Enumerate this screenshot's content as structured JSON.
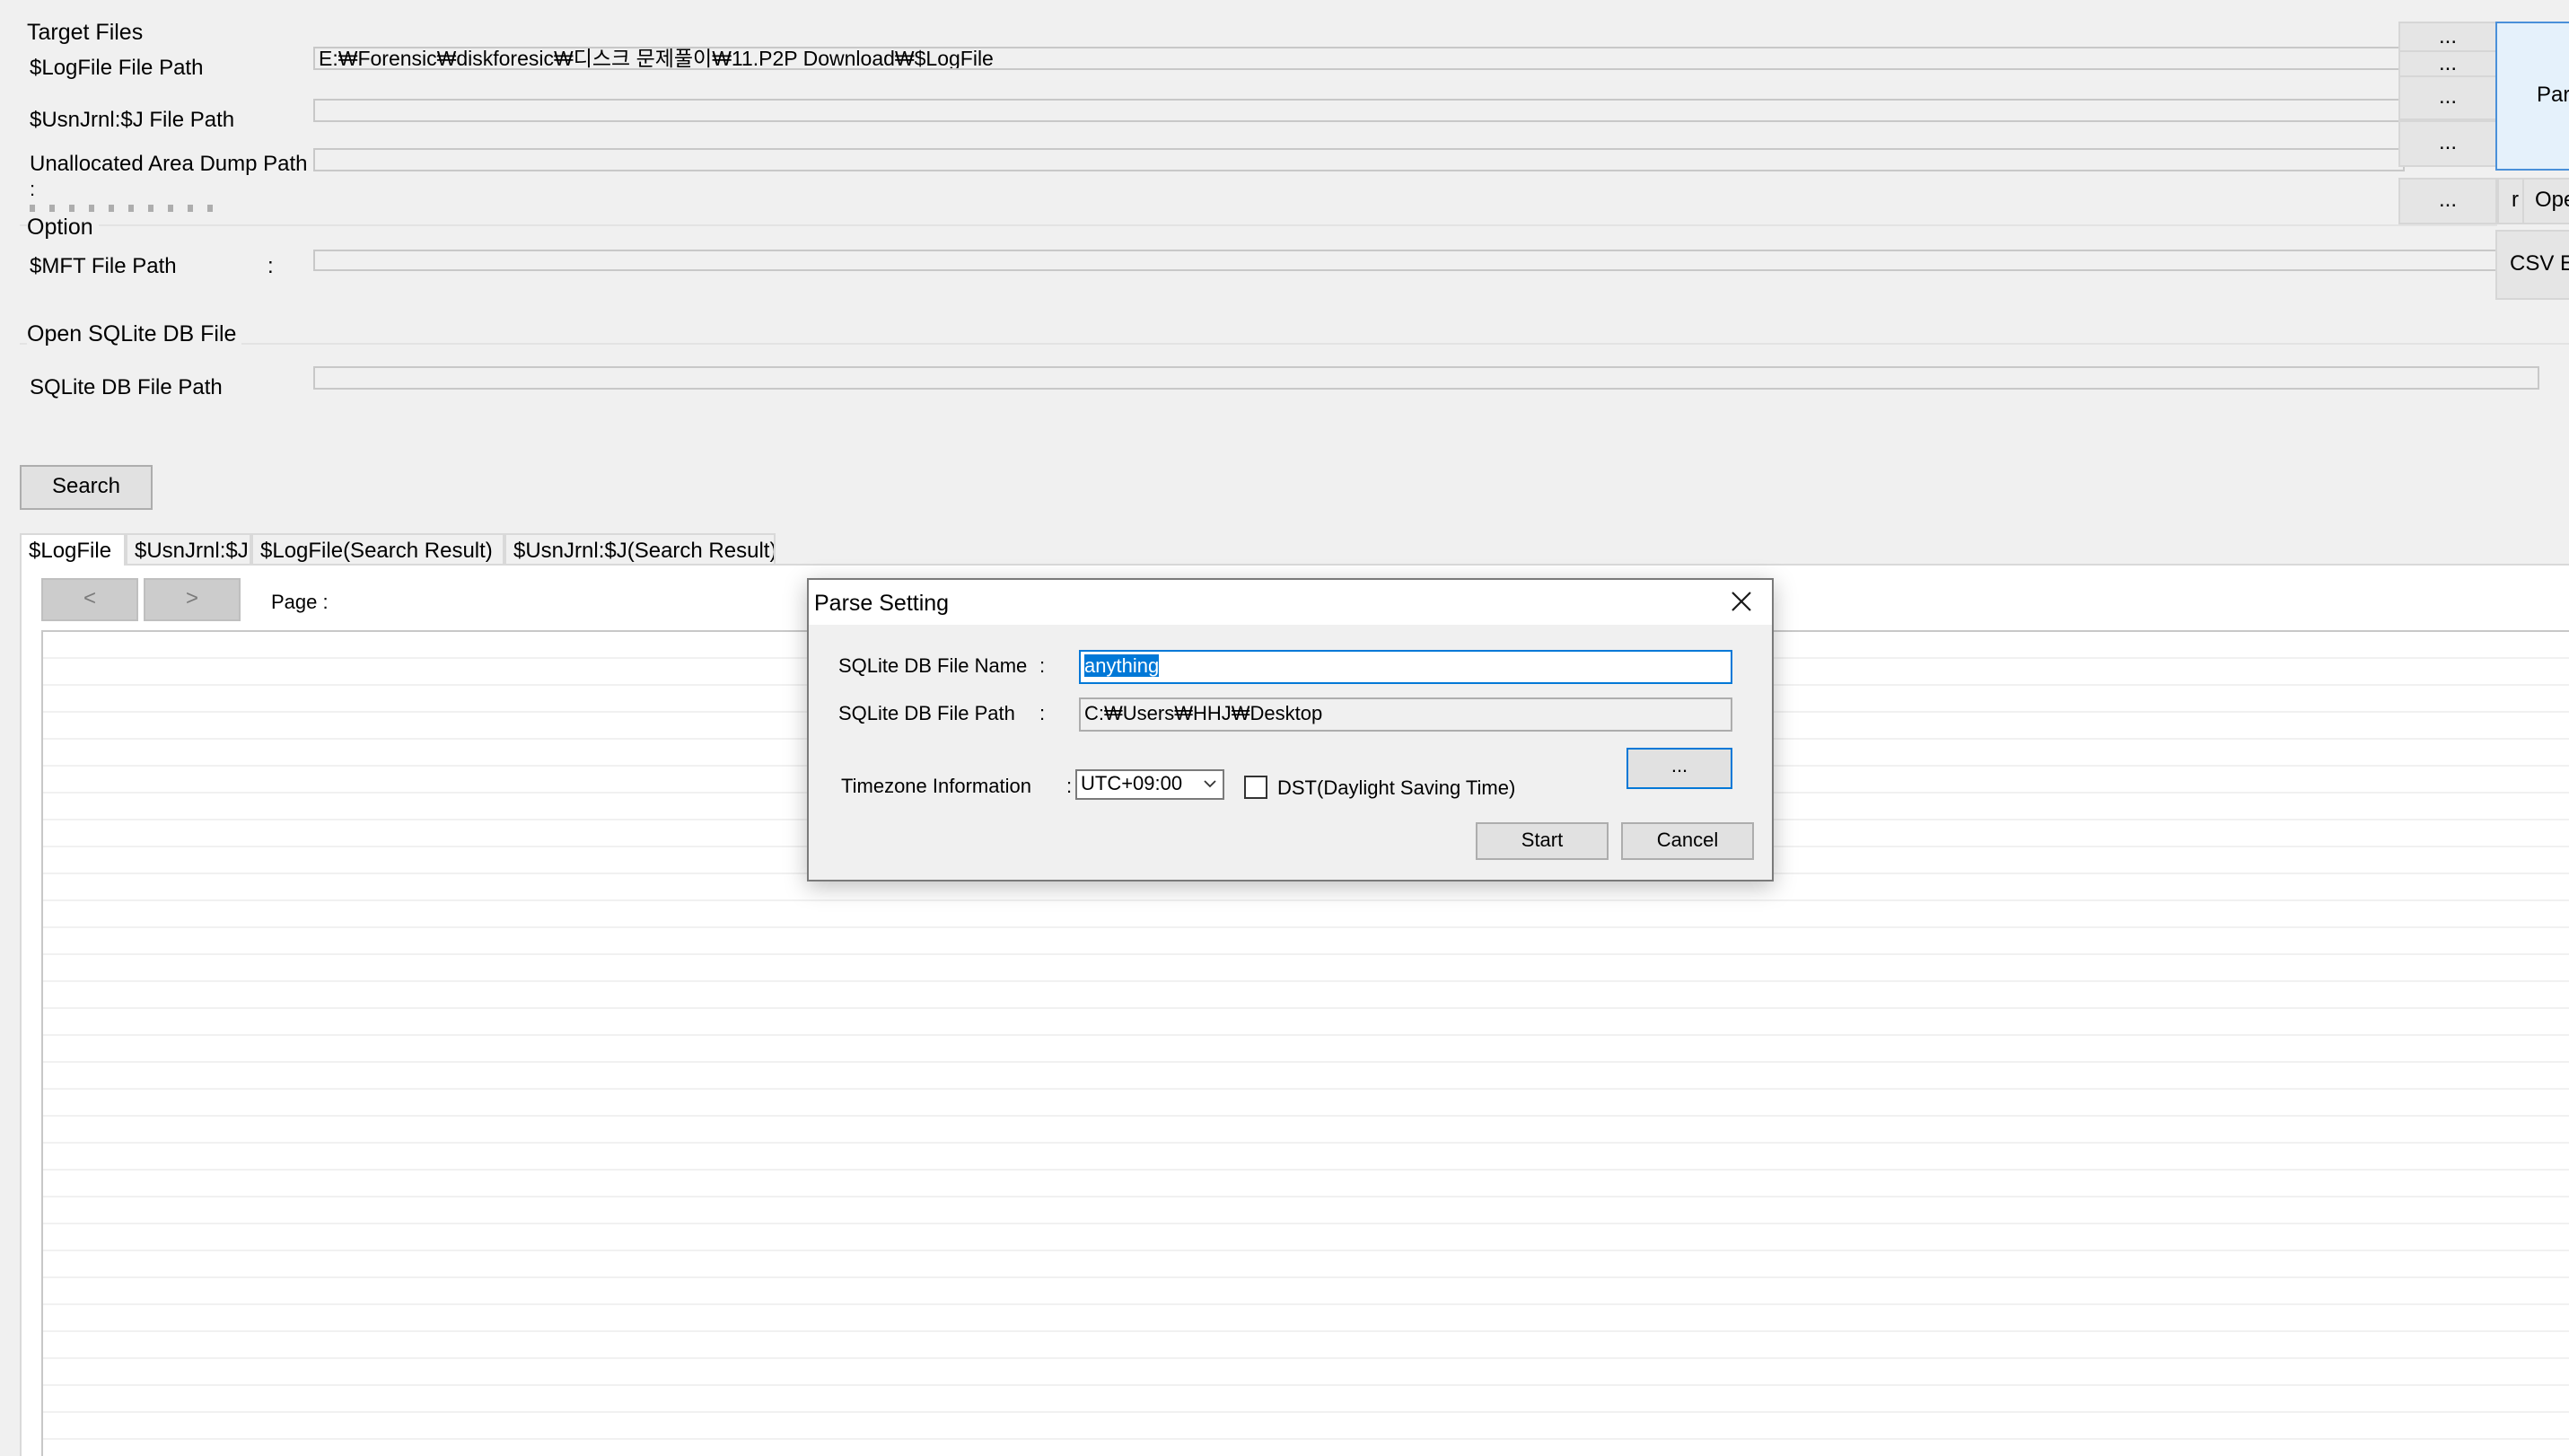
{
  "target_files": {
    "title": "Target Files",
    "logfile_label": "$LogFile File Path",
    "logfile_value": "E:₩Forensic₩diskforesic₩디스크 문제풀이₩11.P2P Download₩$LogFile",
    "usnjrnl_label": "$UsnJrnl:$J File Path",
    "usnjrnl_value": "",
    "unalloc_label": "Unallocated Area Dump Path",
    "unalloc_colon": ":",
    "browse_label": "...",
    "parse_button": "Par",
    "clear_button": "r",
    "open_button": "Ope",
    "csv_button": "CSV E"
  },
  "option": {
    "title": "Option",
    "mft_label": "$MFT File Path",
    "mft_colon": ":",
    "mft_value": ""
  },
  "open_sqlite": {
    "title": "Open SQLite DB File",
    "path_label": "SQLite DB File Path",
    "path_value": ""
  },
  "search_button": "Search",
  "tabs": [
    {
      "label": "$LogFile",
      "active": true
    },
    {
      "label": "$UsnJrnl:$J",
      "active": false
    },
    {
      "label": "$LogFile(Search Result)",
      "active": false
    },
    {
      "label": "$UsnJrnl:$J(Search Result)",
      "active": false
    }
  ],
  "pager": {
    "prev": "<",
    "next": ">",
    "page_label": "Page :"
  },
  "dialog": {
    "title": "Parse Setting",
    "close_icon": "close-icon",
    "db_name_label": "SQLite DB File Name",
    "db_name_colon": ":",
    "db_name_value": "anything",
    "db_path_label": "SQLite DB File Path",
    "db_path_colon": ":",
    "db_path_value": "C:₩Users₩HHJ₩Desktop",
    "browse_label": "...",
    "timezone_label": "Timezone Information",
    "timezone_colon": ":",
    "timezone_value": "UTC+09:00",
    "dst_label": "DST(Daylight Saving Time)",
    "dst_checked": false,
    "start_button": "Start",
    "cancel_button": "Cancel"
  },
  "colors": {
    "background": "#f0f0f0",
    "accent": "#0078d7",
    "selection": "#0078d7"
  }
}
